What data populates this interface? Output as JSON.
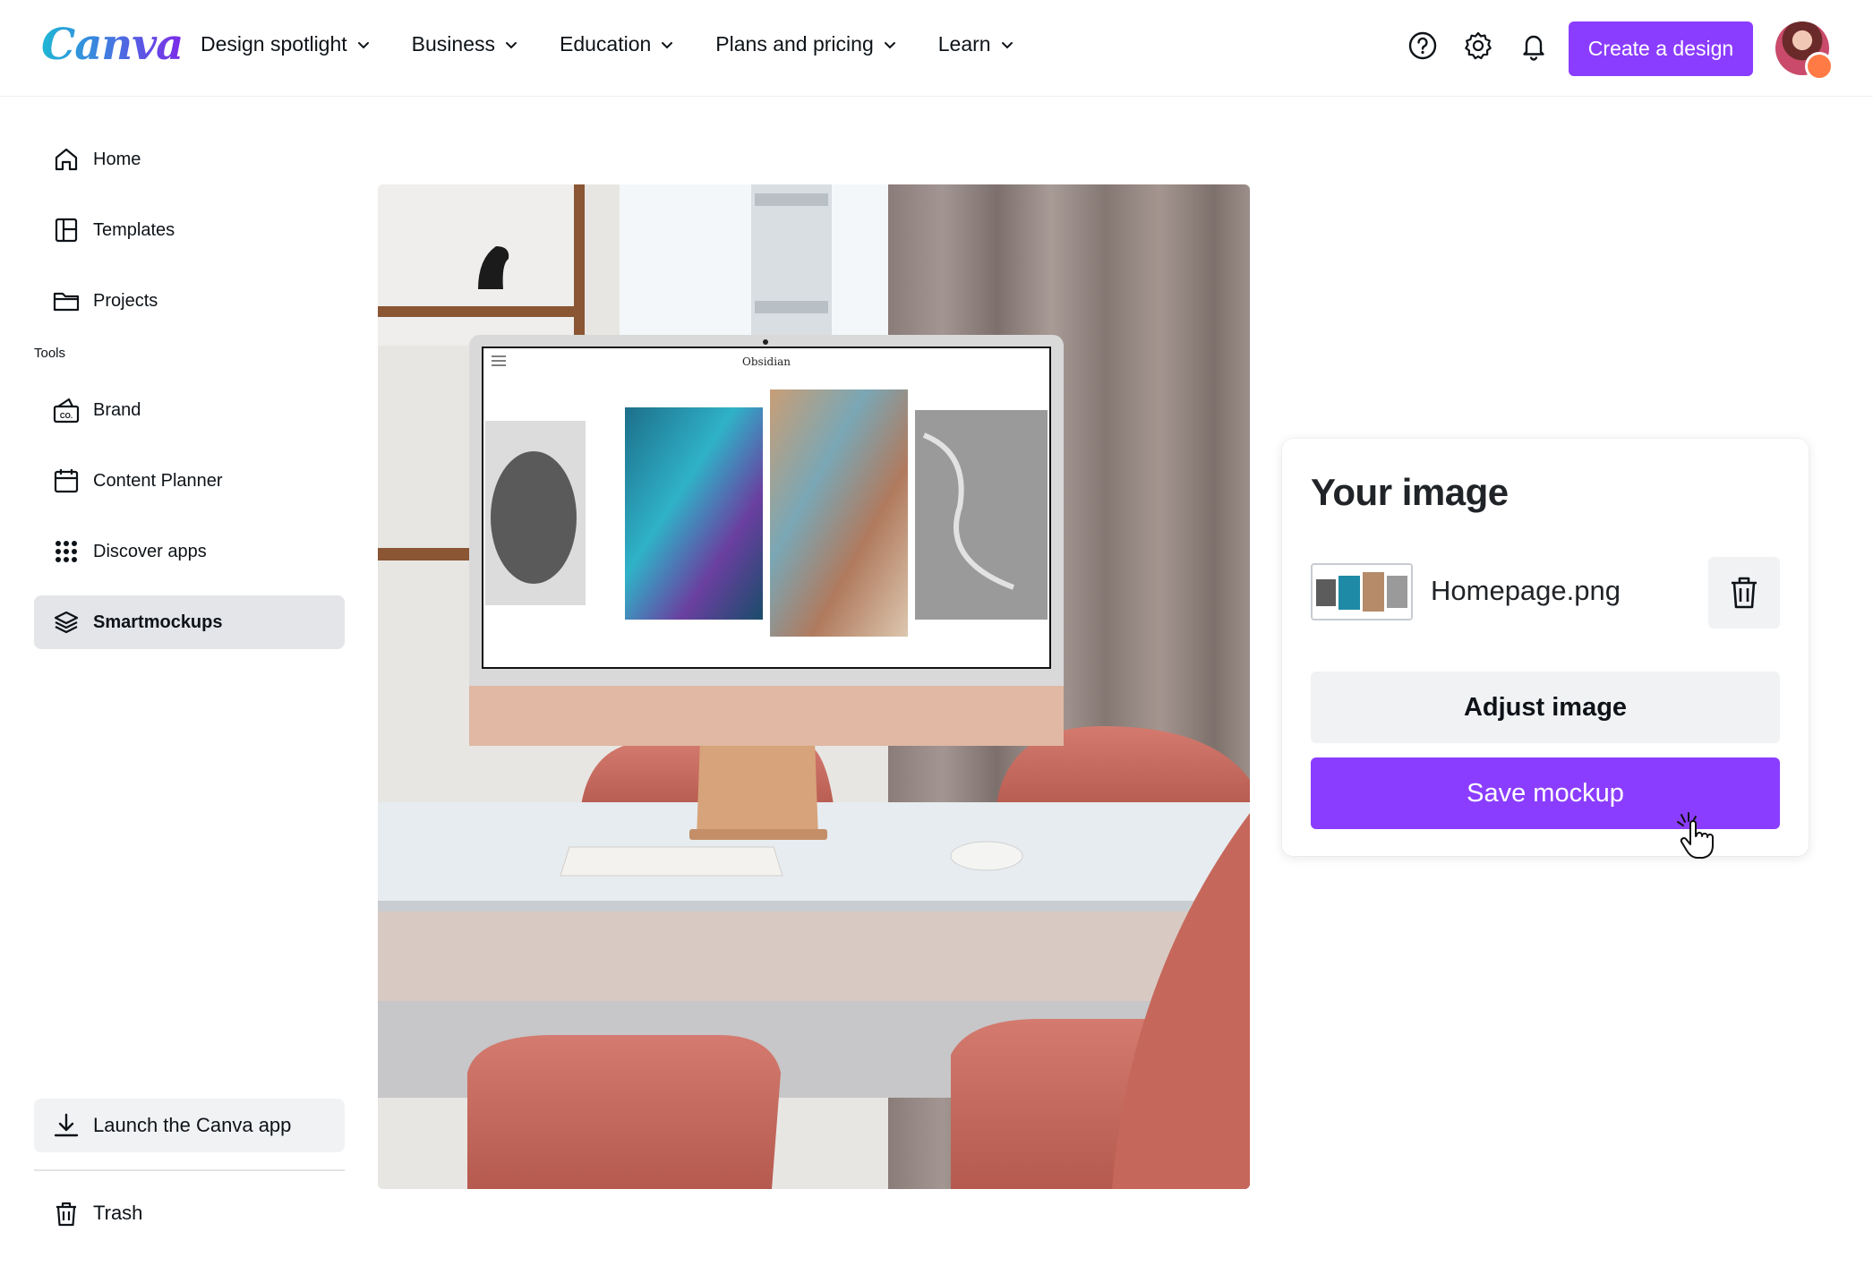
{
  "header": {
    "logo": "Canva",
    "nav": [
      {
        "label": "Design spotlight"
      },
      {
        "label": "Business"
      },
      {
        "label": "Education"
      },
      {
        "label": "Plans and pricing"
      },
      {
        "label": "Learn"
      }
    ],
    "create_button": "Create a design",
    "icons": [
      "help-icon",
      "settings-icon",
      "notifications-icon"
    ]
  },
  "sidebar": {
    "items": [
      {
        "label": "Home",
        "icon": "home-icon"
      },
      {
        "label": "Templates",
        "icon": "templates-icon"
      },
      {
        "label": "Projects",
        "icon": "folder-icon"
      }
    ],
    "tools_heading": "Tools",
    "tools": [
      {
        "label": "Brand",
        "icon": "brand-icon"
      },
      {
        "label": "Content Planner",
        "icon": "calendar-icon"
      },
      {
        "label": "Discover apps",
        "icon": "apps-grid-icon"
      },
      {
        "label": "Smartmockups",
        "icon": "layers-icon",
        "active": true
      }
    ],
    "launch_app": "Launch the Canva app",
    "trash": "Trash"
  },
  "mockup": {
    "screen_site_title": "Obsidian"
  },
  "panel": {
    "title": "Your image",
    "file_name": "Homepage.png",
    "adjust_button": "Adjust image",
    "save_button": "Save mockup"
  },
  "colors": {
    "accent": "#8b3dff",
    "active_bg": "#e4e5e8"
  }
}
